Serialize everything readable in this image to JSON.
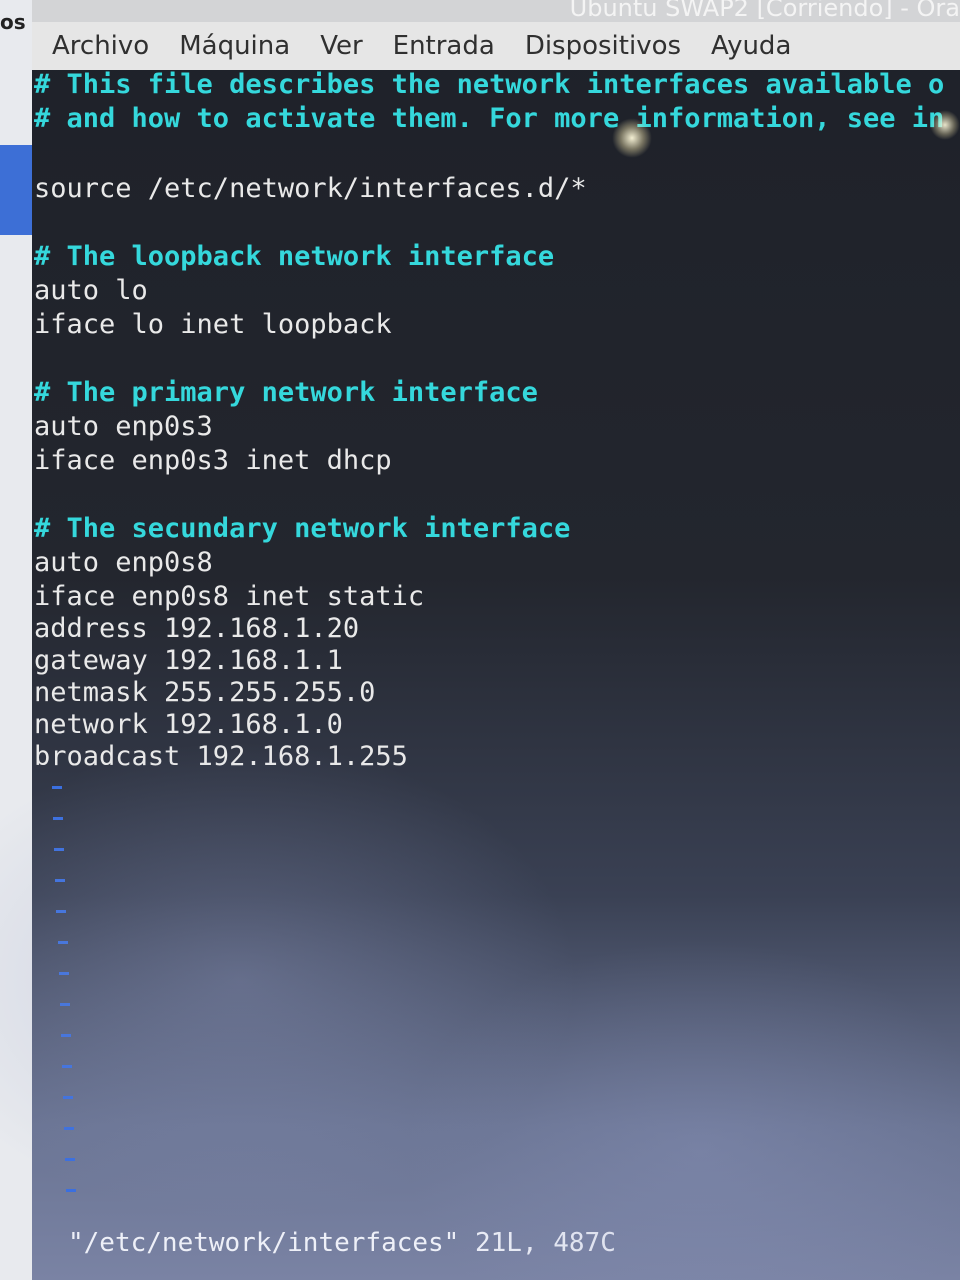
{
  "window": {
    "title": "Ubuntu SWAP2 [Corriendo] - Ora",
    "left_edge_text": "os"
  },
  "menu": {
    "items": [
      "Archivo",
      "Máquina",
      "Ver",
      "Entrada",
      "Dispositivos",
      "Ayuda"
    ]
  },
  "editor": {
    "lines": [
      "# This file describes the network interfaces available o",
      "# and how to activate them. For more information, see in",
      "",
      "source /etc/network/interfaces.d/*",
      "",
      "# The loopback network interface",
      "auto lo",
      "iface lo inet loopback",
      "",
      "# The primary network interface",
      "auto enp0s3",
      "iface enp0s3 inet dhcp",
      "",
      "# The secundary network interface",
      "auto enp0s8",
      "iface enp0s8 inet static",
      "address 192.168.1.20",
      "gateway 192.168.1.1",
      "netmask 255.255.255.0",
      "network 192.168.1.0",
      "broadcast 192.168.1.255"
    ],
    "empty_line_marker": "~",
    "status_line": "\"/etc/network/interfaces\" 21L, 487C"
  },
  "colors": {
    "comment": "#35d8dc",
    "text": "#e9e9e9",
    "tilde": "#3a6fe0",
    "menubar": "#e6e6e6"
  }
}
